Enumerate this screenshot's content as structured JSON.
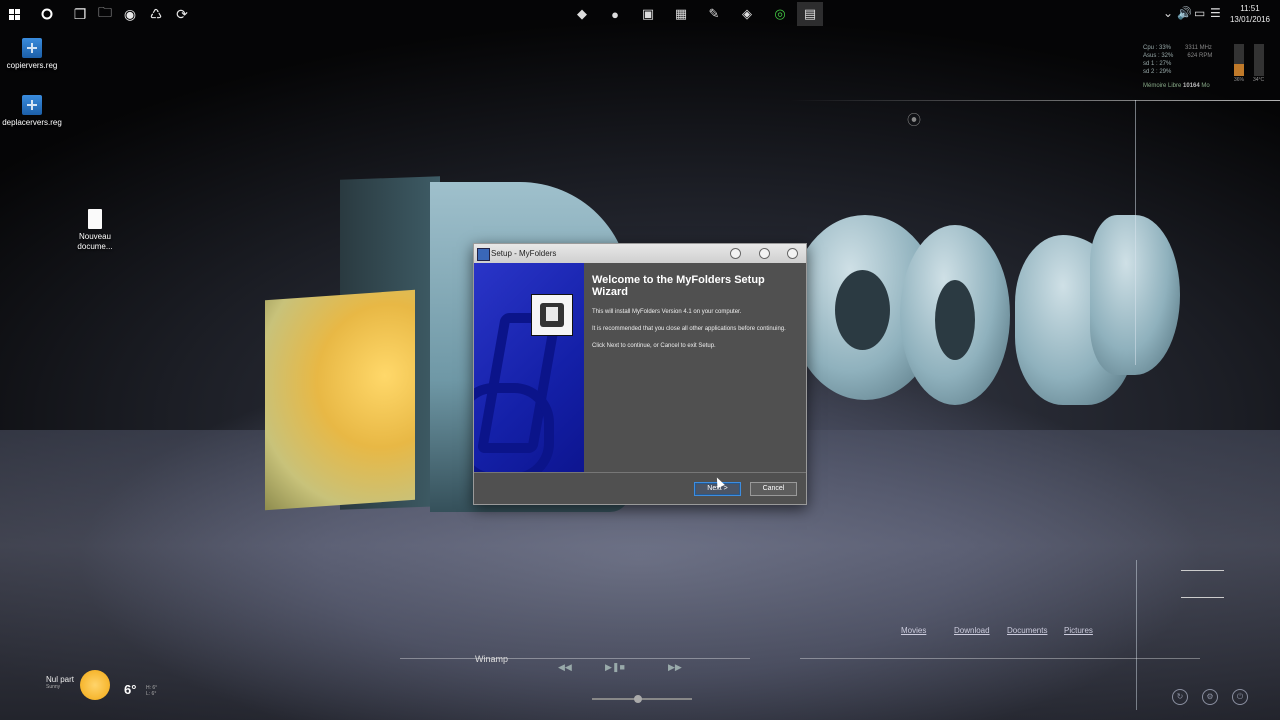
{
  "taskbar": {
    "start_icon": "windows-start-icon",
    "search_icon": "cortana-circle-icon",
    "pinned_left": [
      "task-view-icon",
      "file-explorer-icon",
      "webcam-icon",
      "recycle-tool-icon",
      "sync-icon"
    ],
    "pinned_center": [
      "eraser-icon",
      "disc-icon",
      "notes-icon",
      "gift-icon",
      "notepad-icon",
      "shield-icon",
      "chrome-icon",
      "setup-app-icon"
    ],
    "tray_icons": [
      "chevron-up-icon",
      "volume-icon",
      "network-icon",
      "action-center-icon"
    ],
    "time": "11:51",
    "date": "13/01/2016"
  },
  "desktop_icons": [
    {
      "label": "copiervers.reg"
    },
    {
      "label": "deplacervers.reg"
    },
    {
      "label": "Nouveau docume..."
    }
  ],
  "sysmon": {
    "rows": [
      {
        "label": "Cpu : 33%",
        "value": "3311 MHz"
      },
      {
        "label": "Asus : 32%",
        "value": "624 RPM"
      },
      {
        "label": "sd 1 : 27%",
        "value": ""
      },
      {
        "label": "sd 2 : 29%",
        "value": ""
      }
    ],
    "memory_label": "Mémoire Libre",
    "memory_value": "10164",
    "memory_unit": "Mo",
    "bars": [
      {
        "label": "36%",
        "level": 0.36
      },
      {
        "label": "34°C",
        "level": 0.0
      }
    ]
  },
  "dialog": {
    "title": "Setup - MyFolders",
    "heading": "Welcome to the MyFolders Setup Wizard",
    "paragraphs": [
      "This will install MyFolders Version 4.1 on your computer.",
      "It is recommended that you close all other applications before continuing.",
      "Click Next to continue, or Cancel to exit Setup."
    ],
    "next_label": "Next >",
    "cancel_label": "Cancel"
  },
  "links": [
    "Movies",
    "Download",
    "Documents",
    "Pictures"
  ],
  "player": {
    "name": "Winamp",
    "controls": [
      "previous-icon",
      "play-pause-stop-icon",
      "next-icon"
    ]
  },
  "weather": {
    "location": "Nul part",
    "condition": "Sunny",
    "temp": "6°",
    "high": "H: 6°",
    "low": "L: 6°"
  },
  "bottom_right_buttons": [
    "refresh-icon",
    "settings-icon",
    "power-icon"
  ]
}
